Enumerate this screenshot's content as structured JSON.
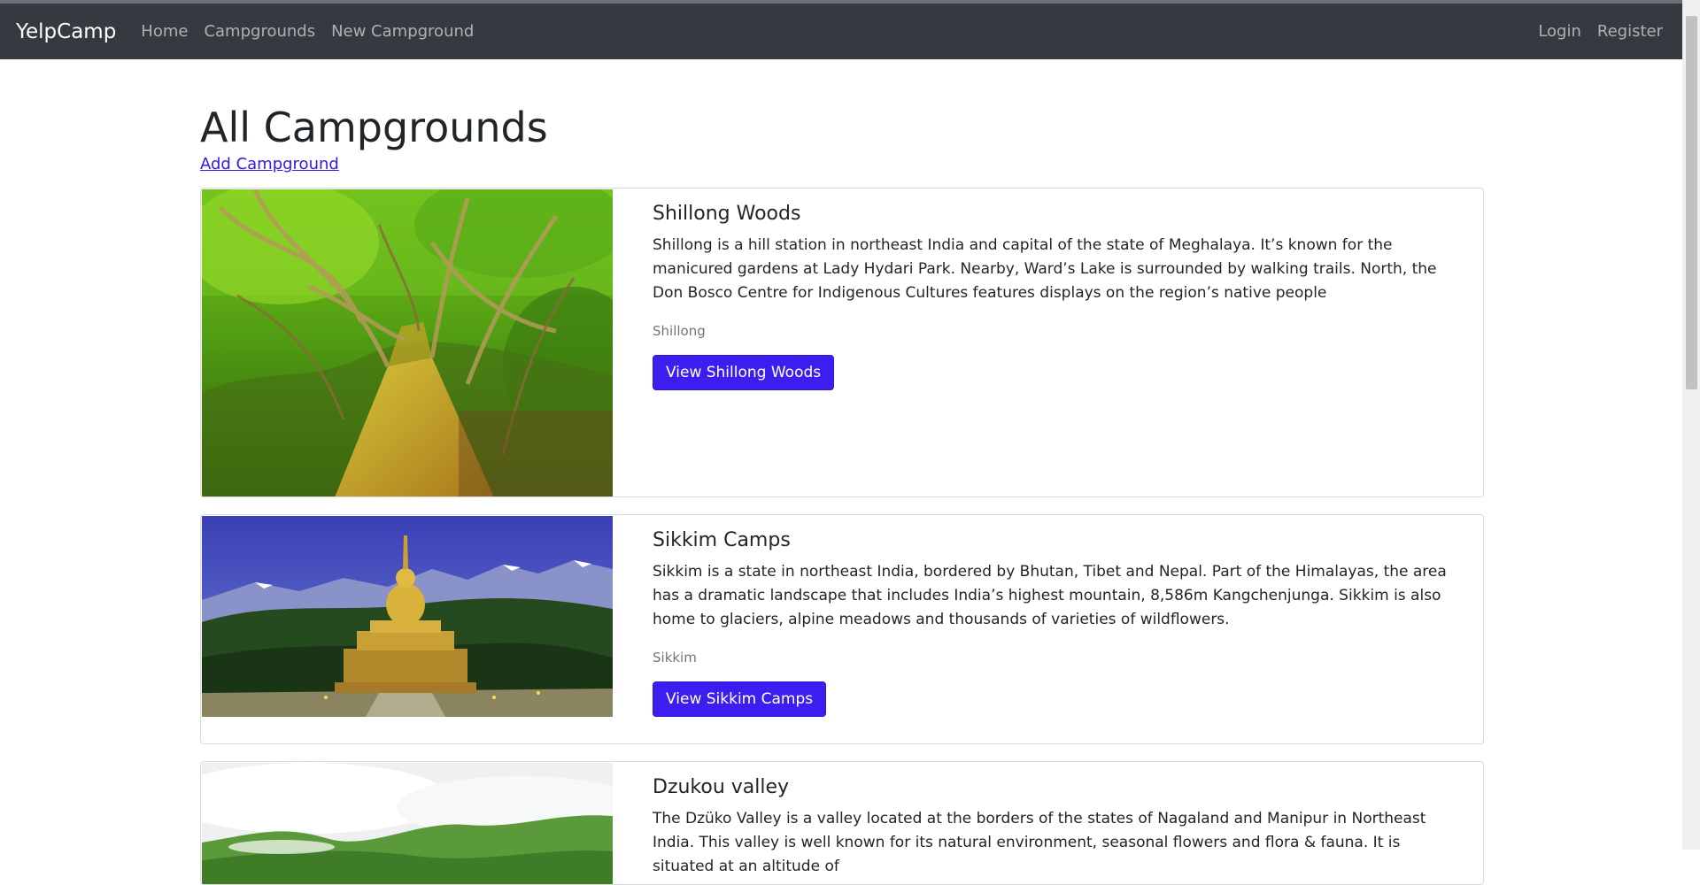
{
  "navbar": {
    "brand": "YelpCamp",
    "links": [
      "Home",
      "Campgrounds",
      "New Campground"
    ],
    "right_links": [
      "Login",
      "Register"
    ]
  },
  "page": {
    "title": "All Campgrounds",
    "add_link": "Add Campground"
  },
  "campgrounds": [
    {
      "title": "Shillong Woods",
      "description": "Shillong is a hill station in northeast India and capital of the state of Meghalaya. It’s known for the manicured gardens at Lady Hydari Park. Nearby, Ward’s Lake is surrounded by walking trails. North, the Don Bosco Centre for Indigenous Cultures features displays on the region’s native people",
      "location": "Shillong",
      "button": "View Shillong Woods",
      "image": "living-root-bridge-forest"
    },
    {
      "title": "Sikkim Camps",
      "description": "Sikkim is a state in northeast India, bordered by Bhutan, Tibet and Nepal. Part of the Himalayas, the area has a dramatic landscape that includes India’s highest mountain, 8,586m Kangchenjunga. Sikkim is also home to glaciers, alpine meadows and thousands of varieties of wildflowers.",
      "location": "Sikkim",
      "button": "View Sikkim Camps",
      "image": "buddha-statue-mountains"
    },
    {
      "title": "Dzukou valley",
      "description": "The Dzüko Valley is a valley located at the borders of the states of Nagaland and Manipur in Northeast India. This valley is well known for its natural environment, seasonal flowers and flora & fauna. It is situated at an altitude of",
      "image": "green-valley-hills"
    }
  ],
  "colors": {
    "navbar": "#343a40",
    "button": "#3c1ff0",
    "link": "#3a16e8",
    "muted": "#6c757d"
  }
}
